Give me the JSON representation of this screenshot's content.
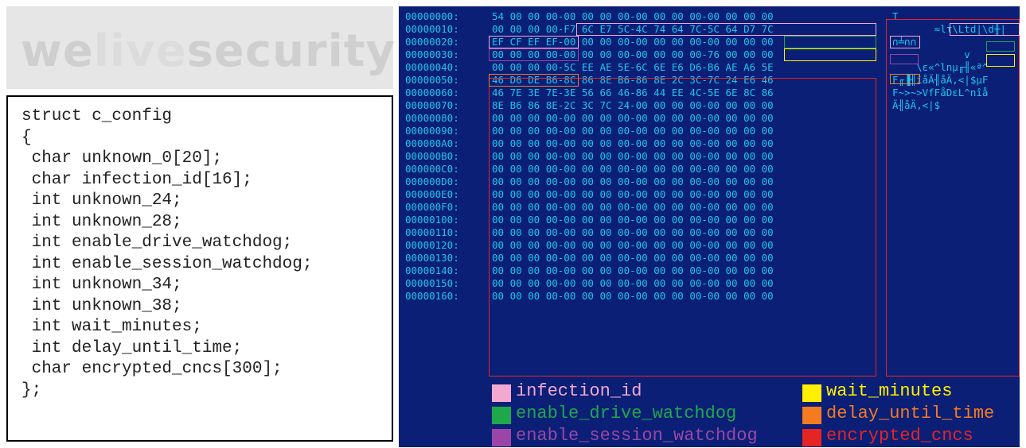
{
  "watermark": {
    "part1": "we",
    "part2": "live",
    "part3": "security"
  },
  "struct_code": "struct c_config\n{\n char unknown_0[20];\n char infection_id[16];\n int unknown_24;\n int unknown_28;\n int enable_drive_watchdog;\n int enable_session_watchdog;\n int unknown_34;\n int unknown_38;\n int wait_minutes;\n int delay_until_time;\n char encrypted_cncs[300];\n};",
  "hex_rows": [
    {
      "addr": "00000000:",
      "bytes": "54 00 00 00-00 00 00 00-00 00 00 00-00 00 00 00",
      "ascii": "T"
    },
    {
      "addr": "00000010:",
      "bytes": "00 00 00 00-F7 6C E7 5C-4C 74 64 7C-5C 64 D7 7C",
      "ascii": "       ≈lτ\\Ltd|\\d╫|"
    },
    {
      "addr": "00000020:",
      "bytes": "EF CF EF EF-00 00 00 00-00 00 00 00-00 00 00 00",
      "ascii": "∩╧∩∩"
    },
    {
      "addr": "00000030:",
      "bytes": "00 00 00 00-00 00 00 00-00 00 00 00-76 00 00 00",
      "ascii": "            v"
    },
    {
      "addr": "00000040:",
      "bytes": "00 00 00 00-5C EE AE 5E-6C 6E E6 D6-B6 AE A6 5E",
      "ascii": "    \\ε«^lnμ╓╢«ª^"
    },
    {
      "addr": "00000050:",
      "bytes": "46 D6 DE B6-8C 86 8E B6-86 8E 2C 3C-7C 24 E6 46",
      "ascii": "F╓▐╢îåÄ╢åÄ,<|$μF"
    },
    {
      "addr": "00000060:",
      "bytes": "46 7E 3E 7E-3E 56 66 46-86 44 EE 4C-5E 6E 8C 86",
      "ascii": "F~>~>VfFåDεL^nîå"
    },
    {
      "addr": "00000070:",
      "bytes": "8E B6 86 8E-2C 3C 7C 24-00 00 00 00-00 00 00 00",
      "ascii": "Ä╢åÄ,<|$"
    },
    {
      "addr": "00000080:",
      "bytes": "00 00 00 00-00 00 00 00-00 00 00 00-00 00 00 00",
      "ascii": ""
    },
    {
      "addr": "00000090:",
      "bytes": "00 00 00 00-00 00 00 00-00 00 00 00-00 00 00 00",
      "ascii": ""
    },
    {
      "addr": "000000A0:",
      "bytes": "00 00 00 00-00 00 00 00-00 00 00 00-00 00 00 00",
      "ascii": ""
    },
    {
      "addr": "000000B0:",
      "bytes": "00 00 00 00-00 00 00 00-00 00 00 00-00 00 00 00",
      "ascii": ""
    },
    {
      "addr": "000000C0:",
      "bytes": "00 00 00 00-00 00 00 00-00 00 00 00-00 00 00 00",
      "ascii": ""
    },
    {
      "addr": "000000D0:",
      "bytes": "00 00 00 00-00 00 00 00-00 00 00 00-00 00 00 00",
      "ascii": ""
    },
    {
      "addr": "000000E0:",
      "bytes": "00 00 00 00-00 00 00 00-00 00 00 00-00 00 00 00",
      "ascii": ""
    },
    {
      "addr": "000000F0:",
      "bytes": "00 00 00 00-00 00 00 00-00 00 00 00-00 00 00 00",
      "ascii": ""
    },
    {
      "addr": "00000100:",
      "bytes": "00 00 00 00-00 00 00 00-00 00 00 00-00 00 00 00",
      "ascii": ""
    },
    {
      "addr": "00000110:",
      "bytes": "00 00 00 00-00 00 00 00-00 00 00 00-00 00 00 00",
      "ascii": ""
    },
    {
      "addr": "00000120:",
      "bytes": "00 00 00 00-00 00 00 00-00 00 00 00-00 00 00 00",
      "ascii": ""
    },
    {
      "addr": "00000130:",
      "bytes": "00 00 00 00-00 00 00 00-00 00 00 00-00 00 00 00",
      "ascii": ""
    },
    {
      "addr": "00000140:",
      "bytes": "00 00 00 00-00 00 00 00-00 00 00 00-00 00 00 00",
      "ascii": ""
    },
    {
      "addr": "00000150:",
      "bytes": "00 00 00 00-00 00 00 00-00 00 00 00-00 00 00 00",
      "ascii": ""
    },
    {
      "addr": "00000160:",
      "bytes": "00 00 00 00-00 00 00 00-00 00 00 00-00 00 00 00",
      "ascii": ""
    }
  ],
  "legend": [
    {
      "name": "infection-id-legend",
      "label": "infection_id",
      "color": "#f3a9cf",
      "text_color": "#f3a9cf"
    },
    {
      "name": "wait-minutes-legend",
      "label": "wait_minutes",
      "color": "#ffef00",
      "text_color": "#ffef00"
    },
    {
      "name": "enable-drive-watchdog-legend",
      "label": "enable_drive_watchdog",
      "color": "#1fa84a",
      "text_color": "#1fa84a"
    },
    {
      "name": "delay-until-time-legend",
      "label": "delay_until_time",
      "color": "#f47b20",
      "text_color": "#f47b20"
    },
    {
      "name": "enable-session-watchdog-legend",
      "label": "enable_session_watchdog",
      "color": "#9b46a6",
      "text_color": "#9b46a6"
    },
    {
      "name": "encrypted-cncs-legend",
      "label": "encrypted_cncs",
      "color": "#e52424",
      "text_color": "#e52424"
    }
  ]
}
